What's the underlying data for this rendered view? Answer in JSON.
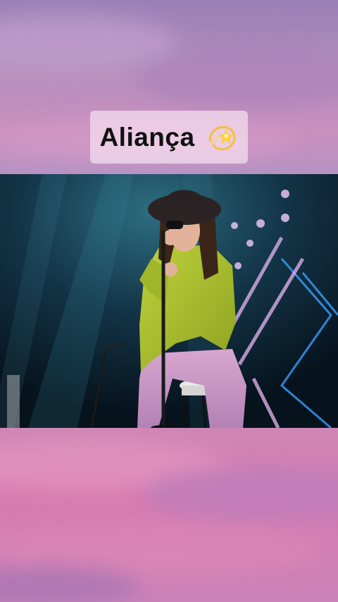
{
  "title": {
    "text": "Aliança",
    "emoji": "dizzy-emoji"
  },
  "colors": {
    "background_top": "#9a7fb5",
    "background_bottom": "#d97ab0",
    "title_card": "#f5e1f0",
    "title_text": "#111111",
    "stage_dark": "#0b2030",
    "jacket": "#a9c02c",
    "trousers": "#c597c4"
  },
  "video": {
    "subject": "performer-image"
  }
}
